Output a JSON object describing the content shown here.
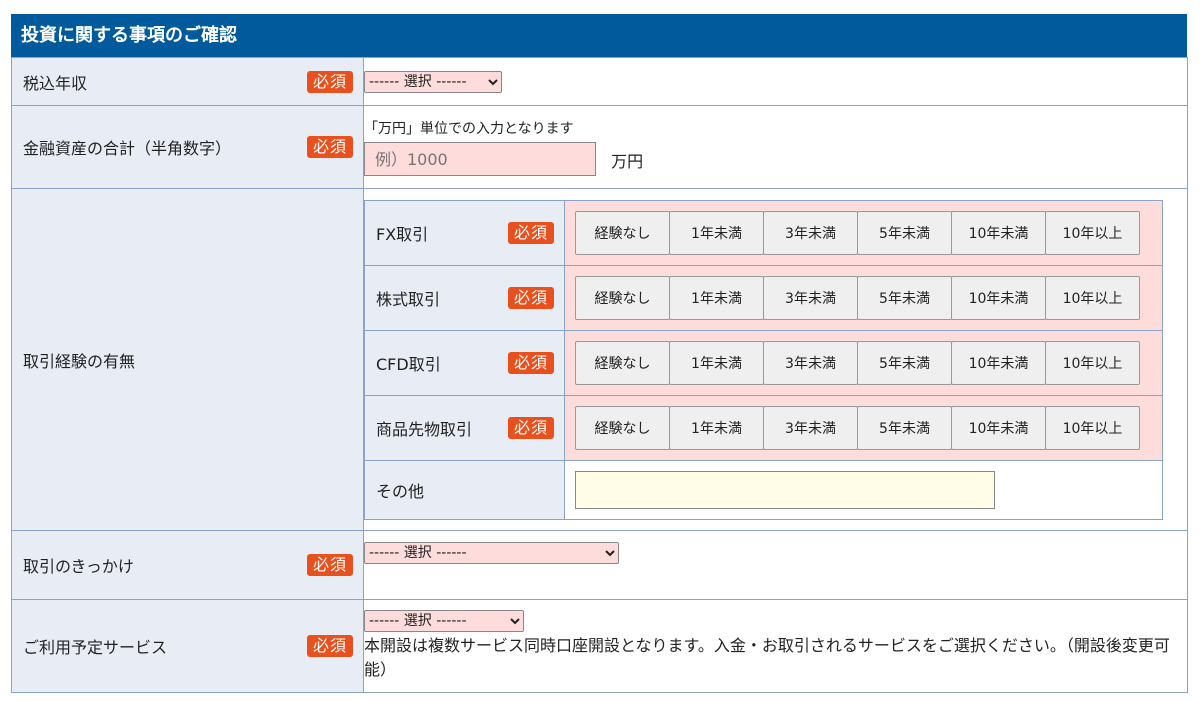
{
  "section": {
    "title": "投資に関する事項のご確認"
  },
  "required_label": "必須",
  "income": {
    "label": "税込年収",
    "select_value": "------ 選択 ------"
  },
  "assets": {
    "label": "金融資産の合計（半角数字）",
    "hint": "「万円」単位での入力となります",
    "placeholder": "例）1000",
    "unit": "万円"
  },
  "experience": {
    "label": "取引経験の有無",
    "options": [
      "経験なし",
      "1年未満",
      "3年未満",
      "5年未満",
      "10年未満",
      "10年以上"
    ],
    "rows": [
      {
        "label": "FX取引"
      },
      {
        "label": "株式取引"
      },
      {
        "label": "CFD取引"
      },
      {
        "label": "商品先物取引"
      }
    ],
    "other_label": "その他"
  },
  "trigger": {
    "label": "取引のきっかけ",
    "select_value": "------ 選択 ------"
  },
  "service": {
    "label": "ご利用予定サービス",
    "select_value": "------ 選択 ------",
    "note": "本開設は複数サービス同時口座開設となります。入金・お取引されるサービスをご選択ください。（開設後変更可能）"
  },
  "colors": {
    "header": "#005a9c",
    "required_badge": "#e8501e",
    "label_bg": "#e8ecf5",
    "required_field_bg": "#ffdcdc",
    "optional_field_bg": "#fffde8"
  }
}
